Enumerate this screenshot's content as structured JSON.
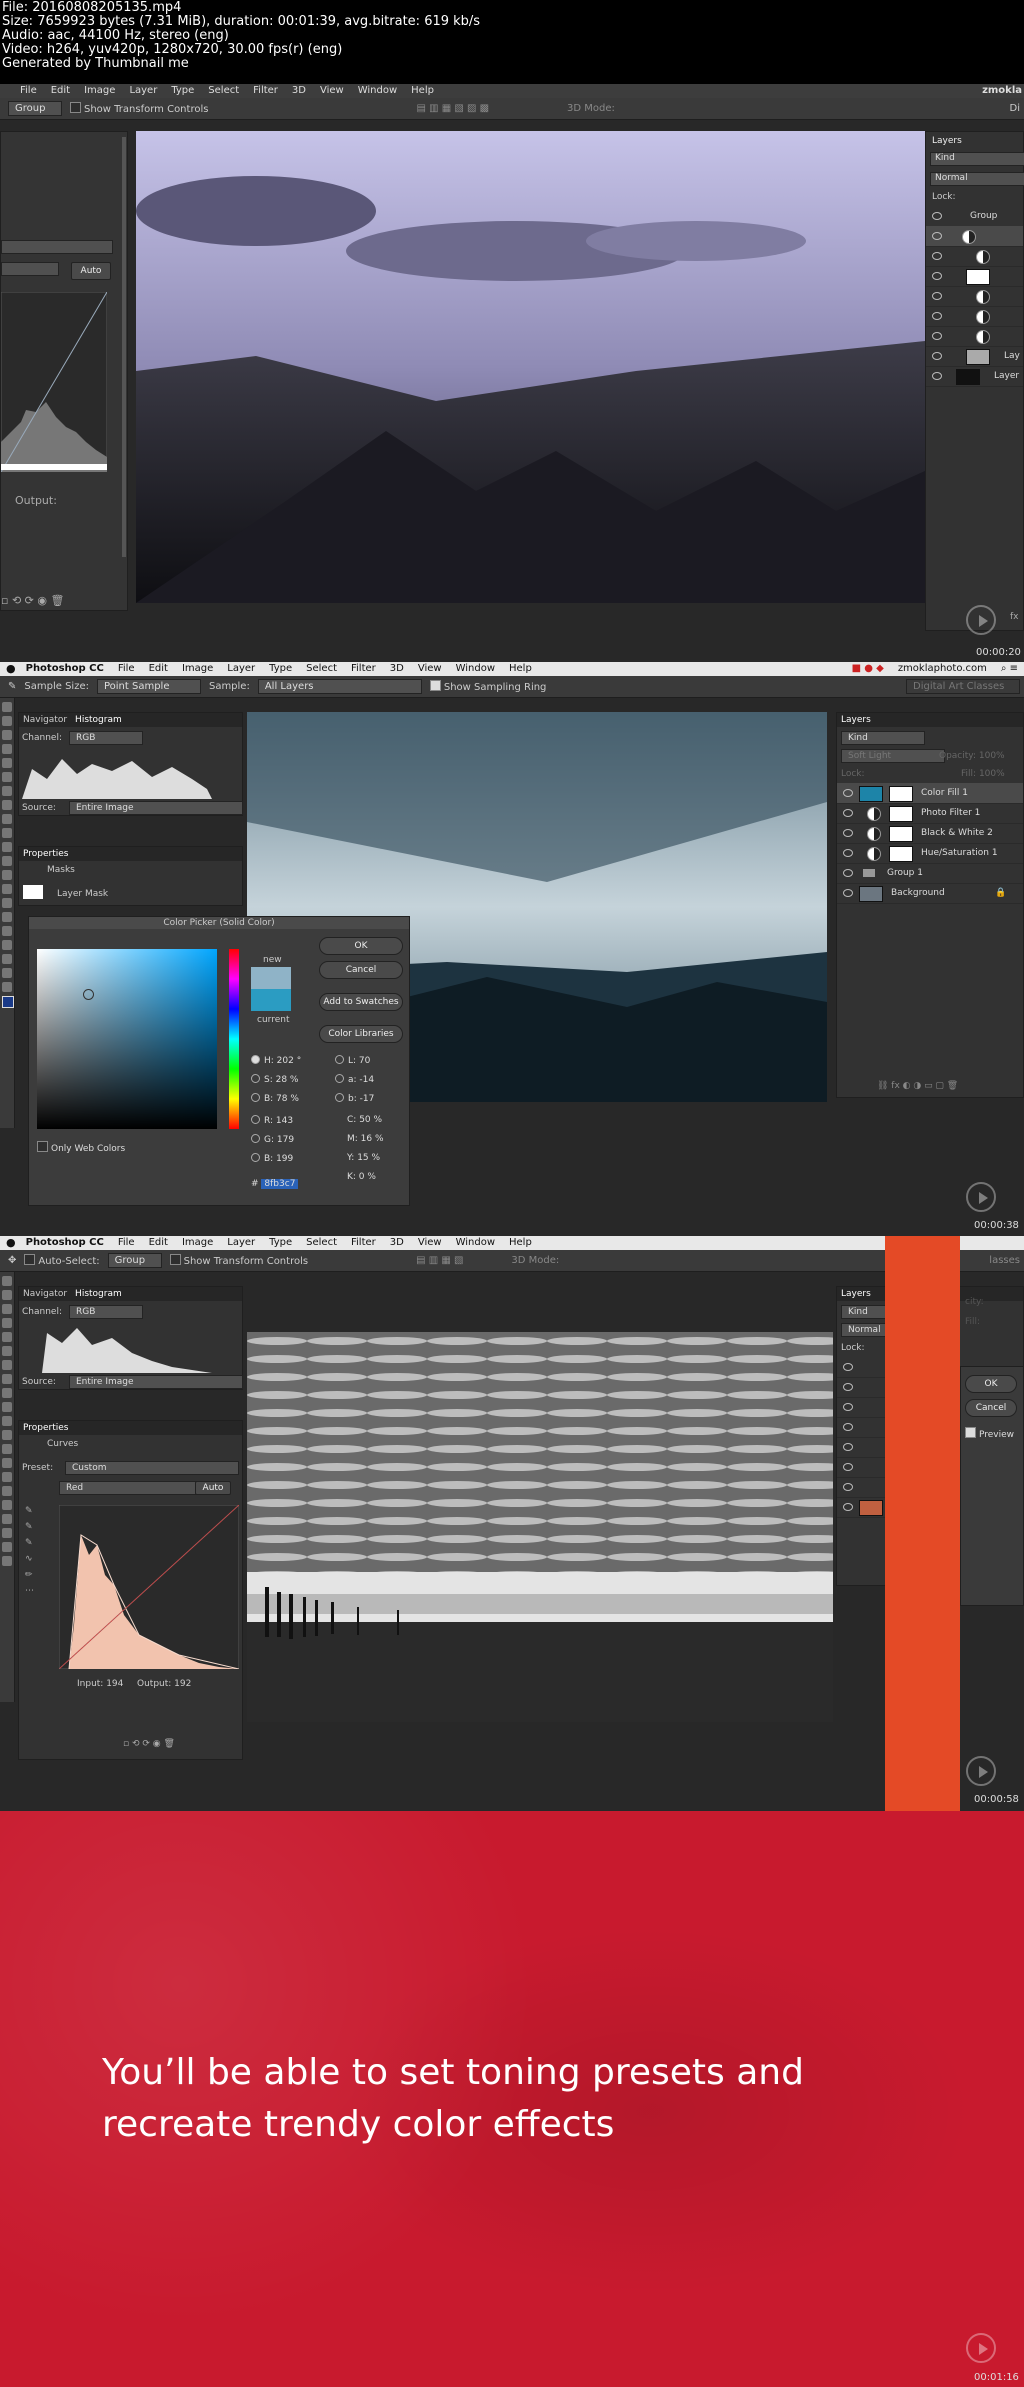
{
  "header": {
    "file": "File: 20160808205135.mp4",
    "size": "Size: 7659923 bytes (7.31 MiB), duration: 00:01:39, avg.bitrate: 619 kb/s",
    "audio": "Audio: aac, 44100 Hz, stereo (eng)",
    "video": "Video: h264, yuv420p, 1280x720, 30.00 fps(r) (eng)",
    "generated": "Generated by Thumbnail me"
  },
  "frame1": {
    "menu": [
      "File",
      "Edit",
      "Image",
      "Layer",
      "Type",
      "Select",
      "Filter",
      "3D",
      "View",
      "Window",
      "Help"
    ],
    "user": "zmokla",
    "options": {
      "group_select": "Group",
      "transform_label": "Show Transform Controls",
      "mode_label": "3D Mode:",
      "right_cut": "Di"
    },
    "curves": {
      "auto": "Auto",
      "output_label": "Output:"
    },
    "layers": {
      "title": "Layers",
      "kind": "Kind",
      "blend": "Normal",
      "lock_label": "Lock:",
      "group_name": "Group",
      "layer_a": "Lay",
      "layer_b": "Layer"
    },
    "timestamp": "00:00:20",
    "fx_label": "fx"
  },
  "frame2": {
    "app_name": "Photoshop CC",
    "menu": [
      "File",
      "Edit",
      "Image",
      "Layer",
      "Type",
      "Select",
      "Filter",
      "3D",
      "View",
      "Window",
      "Help"
    ],
    "site": "zmoklaphoto.com",
    "options": {
      "sample_size_label": "Sample Size:",
      "sample_size": "Point Sample",
      "sample_label": "Sample:",
      "sample": "All Layers",
      "sampling_ring": "Show Sampling Ring",
      "workspace": "Digital Art Classes"
    },
    "navigator": {
      "tab1": "Navigator",
      "tab2": "Histogram",
      "channel_label": "Channel:",
      "channel": "RGB",
      "source_label": "Source:",
      "source": "Entire Image"
    },
    "properties": {
      "title": "Properties",
      "masks": "Masks",
      "layer_mask": "Layer Mask"
    },
    "color_picker": {
      "title": "Color Picker (Solid Color)",
      "ok": "OK",
      "cancel": "Cancel",
      "add_swatches": "Add to Swatches",
      "libraries": "Color Libraries",
      "new_label": "new",
      "current_label": "current",
      "only_web": "Only Web Colors",
      "h": "202",
      "s": "28",
      "b": "78",
      "r": "143",
      "g": "179",
      "b2": "199",
      "l": "70",
      "a": "-14",
      "lab_b": "-17",
      "c": "50",
      "m": "16",
      "y": "15",
      "k": "0",
      "hex": "8fb3c7",
      "new_color": "#8fb3c7",
      "current_color": "#2b9cc2"
    },
    "layers": {
      "title": "Layers",
      "kind": "Kind",
      "blend": "Soft Light",
      "opacity_label": "Opacity:",
      "opacity": "100%",
      "lock_label": "Lock:",
      "fill_label": "Fill:",
      "fill": "100%",
      "items": [
        "Color Fill 1",
        "Photo Filter 1",
        "Black & White 2",
        "Hue/Saturation 1",
        "Group 1",
        "Background"
      ]
    },
    "timestamp": "00:00:38"
  },
  "frame3": {
    "app_name": "Photoshop CC",
    "menu": [
      "File",
      "Edit",
      "Image",
      "Layer",
      "Type",
      "Select",
      "Filter",
      "3D",
      "View",
      "Window",
      "Help"
    ],
    "options": {
      "auto_select": "Auto-Select:",
      "group_select": "Group",
      "transform_label": "Show Transform Controls",
      "mode_label": "3D Mode:",
      "right_text": "lasses"
    },
    "navigator": {
      "tab1": "Navigator",
      "tab2": "Histogram",
      "channel_label": "Channel:",
      "channel": "RGB",
      "source_label": "Source:",
      "source": "Entire Image"
    },
    "properties": {
      "title": "Properties",
      "curves": "Curves",
      "preset_label": "Preset:",
      "preset": "Custom",
      "channel": "Red",
      "auto": "Auto",
      "input": "Input: 194",
      "output": "Output: 192"
    },
    "layers": {
      "title": "Layers",
      "kind": "Kind",
      "blend": "Normal",
      "lock_label": "Lock:",
      "fill_label": "Fill:",
      "opacity_label": "city:"
    },
    "dialog": {
      "ok": "OK",
      "cancel": "Cancel",
      "preview": "Preview"
    },
    "timestamp": "00:00:58"
  },
  "promo": {
    "caption_line1": "You’ll be able to set toning presets and",
    "caption_line2": "recreate trendy color effects",
    "timestamp": "00:01:16"
  }
}
